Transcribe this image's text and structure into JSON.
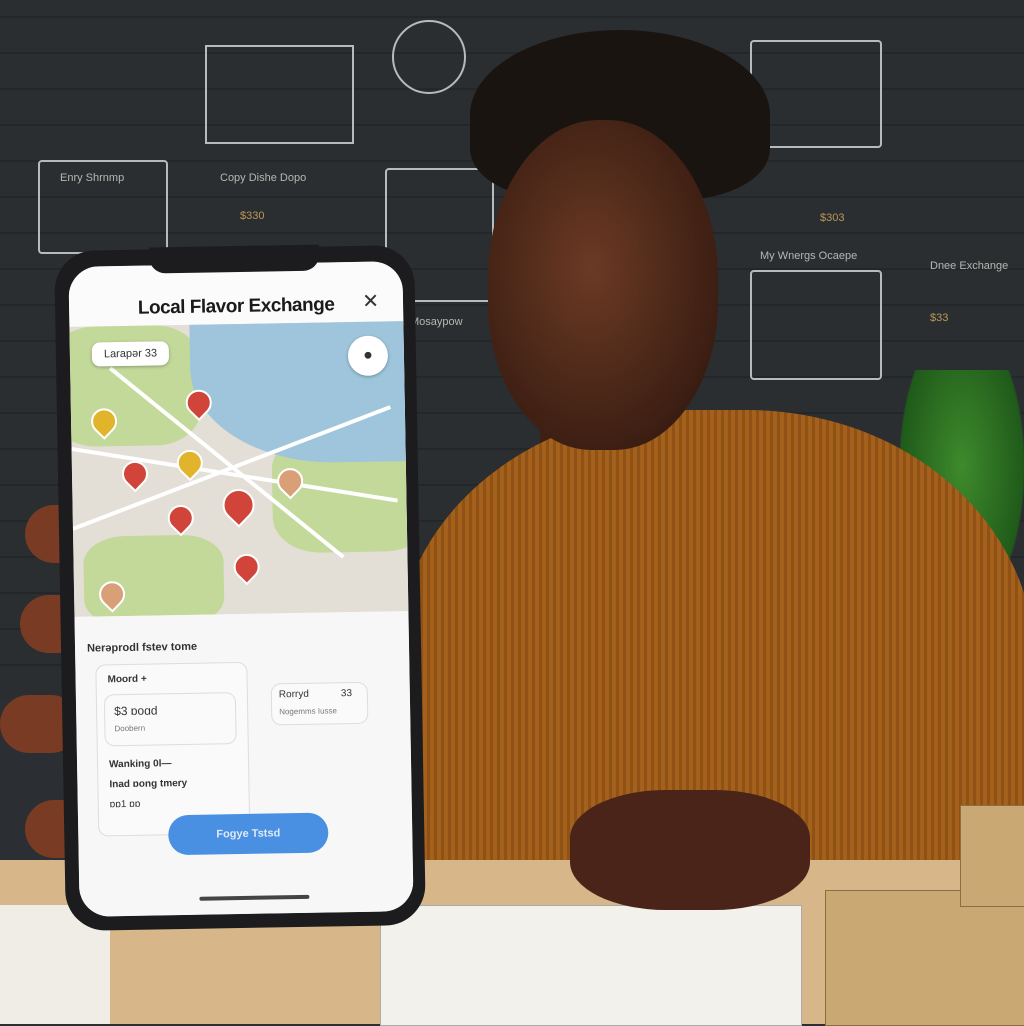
{
  "app": {
    "title": "Local Flavor Exchange",
    "close_icon": "close-icon",
    "search_chip": "Larapər 33",
    "location_button_icon": "location-icon"
  },
  "map": {
    "pin_colors": {
      "red": "#d0443a",
      "yellow": "#e2b42c",
      "tan": "#d9a077"
    }
  },
  "panel": {
    "section_title": "Nerəprodl fstev tome",
    "left_label": "Moord +",
    "card_price": "$3 ɒoɑd",
    "card_sub": "Doobern",
    "list_1": "Wanking 0l—",
    "list_2": "Inad ɒong tmery",
    "list_3": "ɒɒ1 ɒɒ",
    "right_card_title": "Rorryd",
    "right_card_value": "33",
    "right_card_sub": "Nogemms Iusse",
    "cta_label": "Fogye Tstsd"
  },
  "background": {
    "board_1": "Enry Shrnmp",
    "board_2": "Copy Dishe Dopo",
    "board_3": "My Wnergs Ocaepe",
    "board_4": "Dnee Exchange",
    "board_5": "Mosaypow",
    "price_1": "$330",
    "price_2": "$303",
    "price_3": "$33"
  }
}
